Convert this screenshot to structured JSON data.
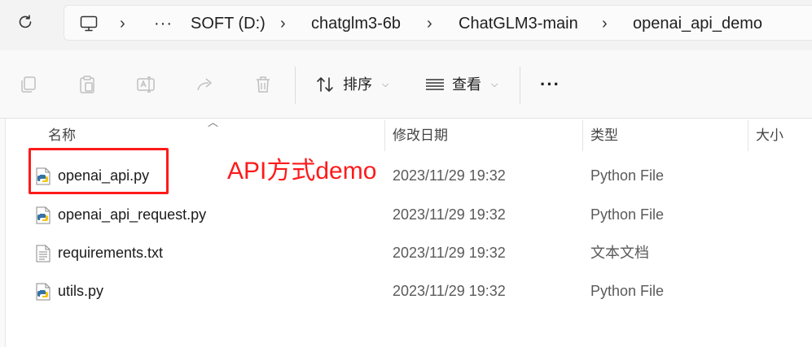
{
  "address_bar": {
    "breadcrumbs": [
      "SOFT (D:)",
      "chatglm3-6b",
      "ChatGLM3-main",
      "openai_api_demo"
    ],
    "overflow": "···",
    "separator": ">"
  },
  "toolbar": {
    "sort_label": "排序",
    "view_label": "查看",
    "more_label": "···"
  },
  "columns": {
    "name": "名称",
    "modified": "修改日期",
    "type": "类型",
    "size": "大小"
  },
  "files": [
    {
      "name": "openai_api.py",
      "modified": "2023/11/29 19:32",
      "type": "Python File",
      "icon": "python-file-icon"
    },
    {
      "name": "openai_api_request.py",
      "modified": "2023/11/29 19:32",
      "type": "Python File",
      "icon": "python-file-icon"
    },
    {
      "name": "requirements.txt",
      "modified": "2023/11/29 19:32",
      "type": "文本文档",
      "icon": "text-file-icon"
    },
    {
      "name": "utils.py",
      "modified": "2023/11/29 19:32",
      "type": "Python File",
      "icon": "python-file-icon"
    }
  ],
  "annotation": {
    "text": "API方式demo",
    "color": "#ff1a1a"
  }
}
